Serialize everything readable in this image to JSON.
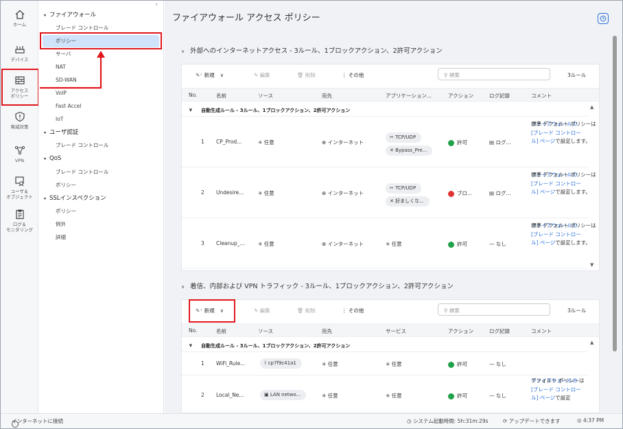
{
  "rail": {
    "items": [
      {
        "name": "home",
        "label": "ホーム"
      },
      {
        "name": "devices",
        "label": "デバイス"
      },
      {
        "name": "access-policy",
        "label1": "アクセス",
        "label2": "ポリシー"
      },
      {
        "name": "threat",
        "label": "脅威対策"
      },
      {
        "name": "vpn",
        "label": "VPN"
      },
      {
        "name": "users",
        "label1": "ユーザ＆",
        "label2": "オブジェクト"
      },
      {
        "name": "logs",
        "label1": "ログ＆",
        "label2": "モニタリング"
      }
    ]
  },
  "nav": {
    "collapse": "‹",
    "items": [
      {
        "label": "ファイアウォール",
        "type": "grp"
      },
      {
        "label": "ブレード コントロール",
        "type": "sub"
      },
      {
        "label": "ポリシー",
        "type": "sel"
      },
      {
        "label": "サーバ",
        "type": "sub"
      },
      {
        "label": "NAT",
        "type": "sub"
      },
      {
        "label": "SD-WAN",
        "type": "sub"
      },
      {
        "label": "VoIP",
        "type": "sub"
      },
      {
        "label": "Fast Accel",
        "type": "sub"
      },
      {
        "label": "IoT",
        "type": "sub"
      },
      {
        "label": "ユーザ認証",
        "type": "grp"
      },
      {
        "label": "ブレード コントロール",
        "type": "sub"
      },
      {
        "label": "QoS",
        "type": "grp"
      },
      {
        "label": "ブレード コントロール",
        "type": "sub"
      },
      {
        "label": "ポリシー",
        "type": "sub"
      },
      {
        "label": "SSLインスペクション",
        "type": "grp"
      },
      {
        "label": "ポリシー",
        "type": "sub"
      },
      {
        "label": "例外",
        "type": "sub"
      },
      {
        "label": "詳細",
        "type": "sub"
      }
    ]
  },
  "page": {
    "title": "ファイアウォール アクセス ポリシー"
  },
  "section1": {
    "heading": "外部へのインターネットアクセス - 3ルール、1ブロックアクション、2許可アクション",
    "toolbar": {
      "new": "新規",
      "edit": "編集",
      "delete": "削除",
      "other": "その他",
      "search_placeholder": "検索",
      "count": "3ルール"
    },
    "columns": [
      "No.",
      "名前",
      "ソース",
      "宛先",
      "アプリケーション...",
      "アクション",
      "ログ記録",
      "コメント"
    ],
    "group": "自動生成ルール - 3ルール、1ブロックアクション、2許可アクション",
    "rows": [
      {
        "no": "1",
        "name": "CP_Prod...",
        "source": "任意",
        "dest": "インターネット",
        "app1": "TCP/UDP",
        "app2": "Bypass_Pre...",
        "action": "許可",
        "log": "ログ...",
        "comment_pre": "標準 デフォルト ポリシーは",
        "comment_link": "ファイアウォールの [ブレード コントロール] ページ",
        "comment_post": "で設定します。"
      },
      {
        "no": "2",
        "name": "Undesire...",
        "source": "任意",
        "dest": "インターネット",
        "app1": "TCP/UDP",
        "app2": "好ましくな...",
        "action": "ブロ...",
        "log": "ログ...",
        "comment_pre": "標準 デフォルト ポリシーは",
        "comment_link": "ファイアウォールの [ブレード コントロール] ページ",
        "comment_post": "で設定します。"
      },
      {
        "no": "3",
        "name": "Cleanup_...",
        "source": "任意",
        "dest": "インターネット",
        "app1": "任意",
        "action": "許可",
        "log": "なし",
        "comment_pre": "標準 デフォルト ポリシーは",
        "comment_link": "ファイアウォールの [ブレード コントロール] ページ",
        "comment_post": "で設定します。"
      }
    ]
  },
  "section2": {
    "heading": "着信、内部および VPN トラフィック - 3ルール、1ブロックアクション、2許可アクション",
    "toolbar": {
      "new": "新規",
      "edit": "編集",
      "delete": "削除",
      "other": "その他",
      "search_placeholder": "検索",
      "count": "3ルール"
    },
    "columns": [
      "No.",
      "名前",
      "ソース",
      "宛先",
      "サービス",
      "アクション",
      "ログ記録",
      "コメント"
    ],
    "group": "自動生成ルール - 3ルール、1ブロックアクション、2許可アクション",
    "rows": [
      {
        "no": "1",
        "name": "WiFi_Rule...",
        "source": "cp7f9c41a1",
        "dest": "任意",
        "service": "任意",
        "action": "許可",
        "log": "なし"
      },
      {
        "no": "2",
        "name": "Local_Ne...",
        "source": "LAN netwo...",
        "dest": "任意",
        "service": "任意",
        "action": "許可",
        "log": "なし",
        "comment_pre": "デフォルト ポリシーは",
        "comment_link": "ファイアウォールの [ブレード コントロール] ページ",
        "comment_post": "で設定"
      }
    ]
  },
  "status": {
    "connection": "インターネットに接続",
    "uptime": "システム起動時間: 5h:31m:29s",
    "update": "アップデートできます",
    "time": "4:37 PM"
  },
  "colors": {
    "accent": "#2a6fdb",
    "highlight": "#e0161b",
    "allow": "#21a24a",
    "block": "#e03434",
    "selected": "#cfe3fa"
  }
}
